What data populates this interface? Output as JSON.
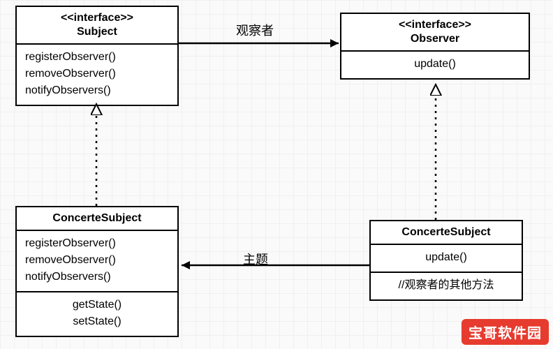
{
  "boxes": {
    "subject": {
      "stereotype": "<<interface>>",
      "name": "Subject",
      "methods": [
        "registerObserver()",
        "removeObserver()",
        "notifyObservers()"
      ]
    },
    "observer": {
      "stereotype": "<<interface>>",
      "name": "Observer",
      "methods": [
        "update()"
      ]
    },
    "concreteSubject": {
      "name": "ConcerteSubject",
      "methods": [
        "registerObserver()",
        "removeObserver()",
        "notifyObservers()"
      ],
      "methods2": [
        "getState()",
        "setState()"
      ]
    },
    "concreteObserver": {
      "name": "ConcerteSubject",
      "methods": [
        "update()"
      ],
      "note": "//观察者的其他方法"
    }
  },
  "labels": {
    "observerRel": "观察者",
    "subjectRel": "主题"
  },
  "watermark": "宝哥软件园"
}
